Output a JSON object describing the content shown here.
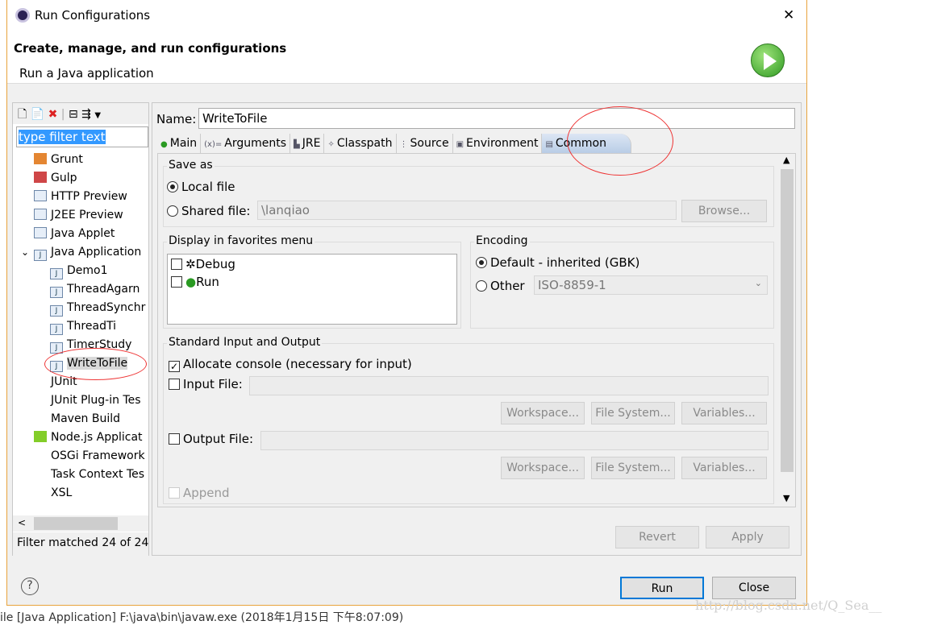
{
  "window": {
    "title": "Run Configurations",
    "close": "✕"
  },
  "header": {
    "title": "Create, manage, and run configurations",
    "subtitle": "Run a Java application"
  },
  "sidebar": {
    "filter_placeholder": "type filter text",
    "items": [
      {
        "label": "Grunt",
        "icon": "grunt-icon",
        "level": 0
      },
      {
        "label": "Gulp",
        "icon": "gulp-icon",
        "level": 0
      },
      {
        "label": "HTTP Preview",
        "icon": "server-icon",
        "level": 0
      },
      {
        "label": "J2EE Preview",
        "icon": "server-icon",
        "level": 0
      },
      {
        "label": "Java Applet",
        "icon": "applet-icon",
        "level": 0
      },
      {
        "label": "Java Application",
        "icon": "java-app-icon",
        "level": 0,
        "expanded": true
      },
      {
        "label": "Demo1",
        "icon": "java-app-icon",
        "level": 1
      },
      {
        "label": "ThreadAgarn",
        "icon": "java-app-icon",
        "level": 1
      },
      {
        "label": "ThreadSynchr",
        "icon": "java-app-icon",
        "level": 1
      },
      {
        "label": "ThreadTi",
        "icon": "java-app-icon",
        "level": 1
      },
      {
        "label": "TimerStudy",
        "icon": "java-app-icon",
        "level": 1
      },
      {
        "label": "WriteToFile",
        "icon": "java-app-icon",
        "level": 1,
        "selected": true
      },
      {
        "label": "JUnit",
        "icon": "junit-icon",
        "level": 0
      },
      {
        "label": "JUnit Plug-in Tes",
        "icon": "junit-icon",
        "level": 0
      },
      {
        "label": "Maven Build",
        "icon": "maven-icon",
        "level": 0
      },
      {
        "label": "Node.js Applicat",
        "icon": "nodejs-icon",
        "level": 0
      },
      {
        "label": "OSGi Framework",
        "icon": "osgi-icon",
        "level": 0
      },
      {
        "label": "Task Context Tes",
        "icon": "junit-icon",
        "level": 0
      },
      {
        "label": "XSL",
        "icon": "xsl-icon",
        "level": 0
      }
    ],
    "status": "Filter matched 24 of 24"
  },
  "config": {
    "name_label": "Name:",
    "name_value": "WriteToFile",
    "tabs": [
      "Main",
      "Arguments",
      "JRE",
      "Classpath",
      "Source",
      "Environment",
      "Common"
    ],
    "active_tab": "Common",
    "save_as": {
      "label": "Save as",
      "local": "Local file",
      "shared": "Shared file:",
      "shared_value": "\\lanqiao",
      "browse": "Browse..."
    },
    "favorites": {
      "label": "Display in favorites menu",
      "items": [
        "Debug",
        "Run"
      ]
    },
    "encoding": {
      "label": "Encoding",
      "default": "Default - inherited (GBK)",
      "other": "Other",
      "other_value": "ISO-8859-1"
    },
    "stdio": {
      "label": "Standard Input and Output",
      "allocate": "Allocate console (necessary for input)",
      "input": "Input File:",
      "output": "Output File:",
      "workspace": "Workspace...",
      "filesystem": "File System...",
      "variables": "Variables...",
      "append": "Append"
    },
    "revert": "Revert",
    "apply": "Apply"
  },
  "footer": {
    "help": "?",
    "run": "Run",
    "close": "Close"
  },
  "background": {
    "status_line": "ile [Java Application] F:\\java\\bin\\javaw.exe (2018年1月15日 下午8:07:09)",
    "watermark": "http://blog.csdn.net/Q_Sea__"
  }
}
